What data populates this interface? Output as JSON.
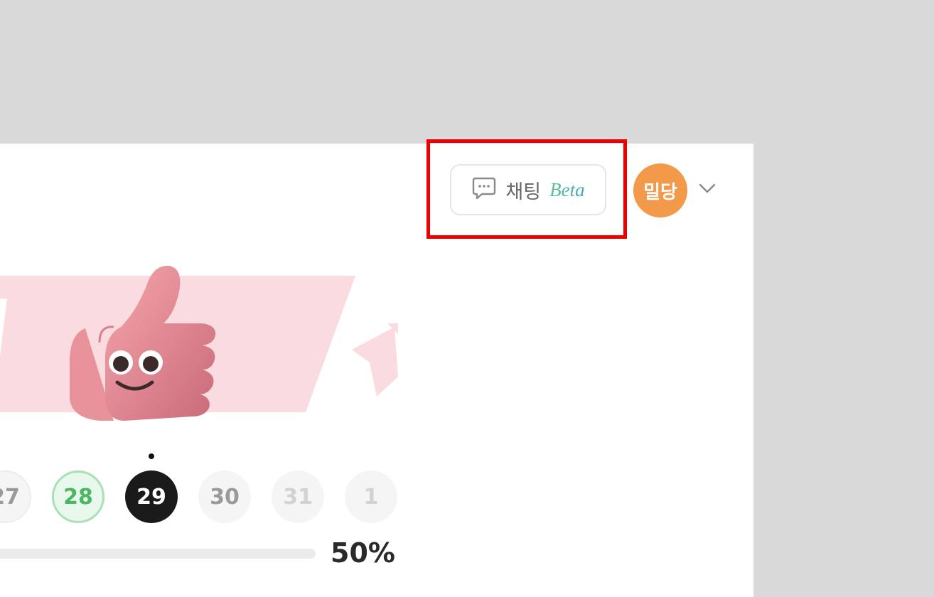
{
  "header": {
    "chat_label": "채팅",
    "chat_beta": "Beta",
    "avatar_text": "밀당"
  },
  "calendar": {
    "days": [
      "27",
      "28",
      "29",
      "30",
      "31",
      "1"
    ],
    "selected": "29"
  },
  "progress": {
    "value": 0.5,
    "label": "50%"
  },
  "colors": {
    "avatar_bg": "#f2994a",
    "selected_day_bg": "#1a1a1a",
    "done_day": "#4cb664",
    "highlight": "#ee0000"
  },
  "icons": {
    "chat": "chat-bubble-icon",
    "dropdown": "chevron-down-icon",
    "illustration": "thumbs-up-illustration"
  }
}
